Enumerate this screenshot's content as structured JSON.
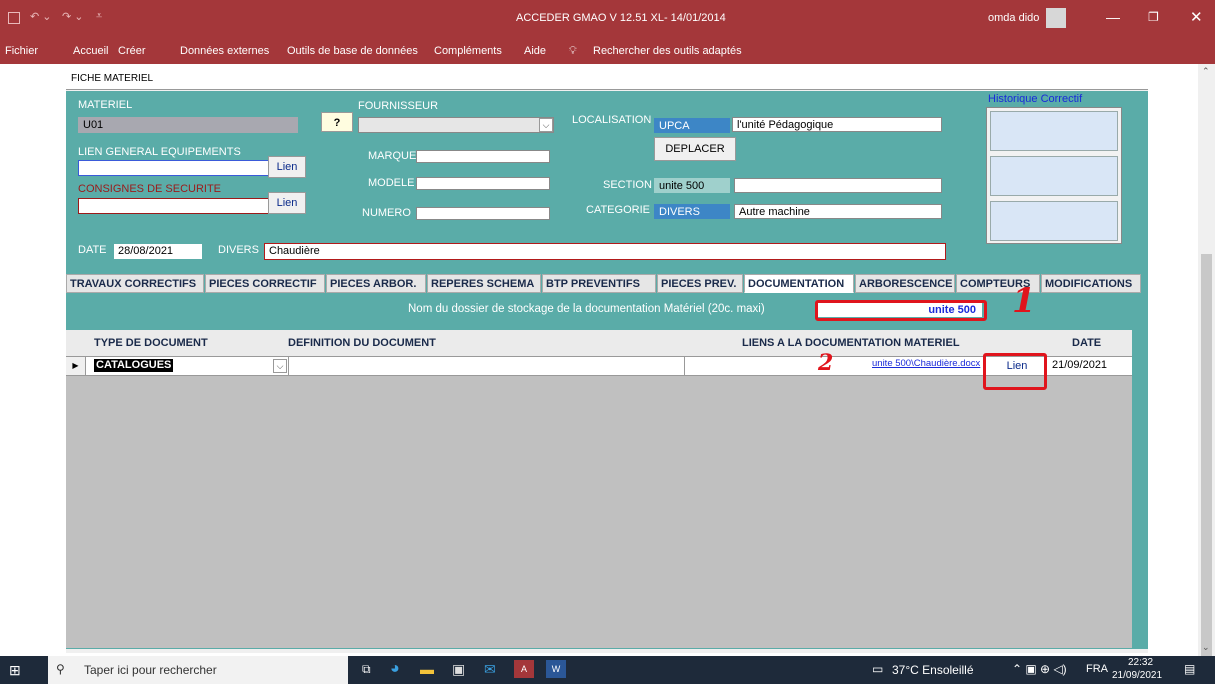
{
  "window": {
    "title": "ACCEDER GMAO V 12.51  XL- 14/01/2014",
    "user": "omda dido"
  },
  "menu": [
    "Fichier",
    "Accueil",
    "Créer",
    "Données externes",
    "Outils de base de données",
    "Compléments",
    "Aide"
  ],
  "tell_me": "Rechercher des outils adaptés",
  "form": {
    "header": "FICHE MATERIEL",
    "materiel_label": "MATERIEL",
    "materiel_value": "U01",
    "lien_general_label": "LIEN GENERAL EQUIPEMENTS",
    "lien_general_value": "",
    "lien_btn": "Lien",
    "consignes_label": "CONSIGNES DE SECURITE",
    "consignes_value": "",
    "fournisseur_label": "FOURNISSEUR",
    "fournisseur_btn": "?",
    "fournisseur_value": "",
    "marque_label": "MARQUE",
    "modele_label": "MODELE",
    "numero_label": "NUMERO",
    "localisation_label": "LOCALISATION",
    "localisation_code": "UPCA",
    "localisation_text": "l'unité Pédagogique",
    "deplacer_btn": "DEPLACER",
    "section_label": "SECTION",
    "section_code": "unite 500",
    "section_text": "",
    "categorie_label": "CATEGORIE",
    "categorie_code": "DIVERS",
    "categorie_text": "Autre machine",
    "historique_label": "Historique  Correctif",
    "date_label": "DATE",
    "date_value": "28/08/2021",
    "divers_label": "DIVERS",
    "divers_value": "Chaudière"
  },
  "tabs": [
    "TRAVAUX CORRECTIFS",
    "PIECES CORRECTIF",
    "PIECES ARBOR.",
    "REPERES SCHEMA",
    "BTP PREVENTIFS",
    "PIECES PREV.",
    "DOCUMENTATION",
    "ARBORESCENCE",
    "COMPTEURS",
    "MODIFICATIONS"
  ],
  "documentation": {
    "dossier_label": "Nom du dossier de stockage de la documentation Matériel  (20c. maxi)",
    "dossier_value": "unite 500",
    "columns": [
      "TYPE DE DOCUMENT",
      "DEFINITION DU DOCUMENT",
      "LIENS A LA DOCUMENTATION MATERIEL",
      "DATE"
    ],
    "rows": [
      {
        "type": "CATALOGUES",
        "definition": "",
        "link": "unite 500\\Chaudière.docx",
        "lien_btn": "Lien",
        "date": "21/09/2021"
      }
    ],
    "annotation_1": "1",
    "annotation_2": "2"
  },
  "taskbar": {
    "search_placeholder": "Taper ici pour rechercher",
    "weather": "37°C  Ensoleillé",
    "lang": "FRA",
    "time": "22:32",
    "date": "21/09/2021"
  },
  "colors": {
    "access_red": "#a4373a",
    "form_teal": "#5aaca8",
    "annotation_red": "#e0141c"
  }
}
